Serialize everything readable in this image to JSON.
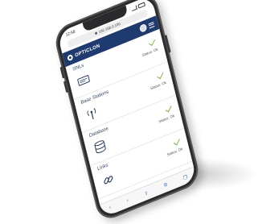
{
  "status_bar": {
    "time": "12:58"
  },
  "browser": {
    "url": "192.168.0.100"
  },
  "app": {
    "brand": "OPTICLON"
  },
  "items": [
    {
      "label": "SNLs",
      "status": "Status: Ok",
      "icon": "device-panel-icon"
    },
    {
      "label": "Base Stations",
      "status": "Status: Ok",
      "icon": "antenna-icon"
    },
    {
      "label": "Database",
      "status": "Status: Ok",
      "icon": "database-icon"
    },
    {
      "label": "Links",
      "status": "Status: Ok",
      "icon": "link-icon"
    }
  ],
  "bottom_bar": {
    "back": "‹",
    "forward": "›",
    "share": "⇪",
    "bookmarks": "⧉",
    "tabs": "❐"
  },
  "colors": {
    "brand": "#1e3a6e",
    "ok_check": "#7cb342",
    "phone_frame": "#2b2b2d"
  }
}
